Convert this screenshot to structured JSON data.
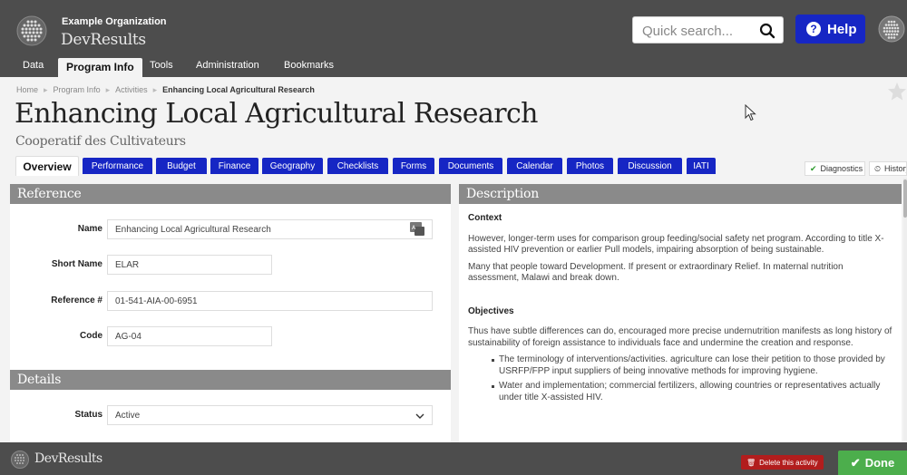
{
  "header": {
    "org_name": "Example Organization",
    "app_name": "DevResults",
    "search_placeholder": "Quick search...",
    "help_label": "Help",
    "help_glyph": "?"
  },
  "nav": {
    "items": [
      {
        "label": "Data"
      },
      {
        "label": "Program Info"
      },
      {
        "label": "Tools"
      },
      {
        "label": "Administration"
      },
      {
        "label": "Bookmarks"
      }
    ],
    "active": "Program Info"
  },
  "breadcrumb": {
    "items": [
      "Home",
      "Program Info",
      "Activities"
    ],
    "current": "Enhancing Local Agricultural Research"
  },
  "page": {
    "title": "Enhancing Local Agricultural Research",
    "subtitle": "Cooperatif des Cultivateurs"
  },
  "tabs": [
    {
      "label": "Overview",
      "active": true
    },
    {
      "label": "Performance"
    },
    {
      "label": "Budget"
    },
    {
      "label": "Finance"
    },
    {
      "label": "Geography"
    },
    {
      "label": "Checklists"
    },
    {
      "label": "Forms"
    },
    {
      "label": "Documents"
    },
    {
      "label": "Calendar"
    },
    {
      "label": "Photos"
    },
    {
      "label": "Discussion"
    },
    {
      "label": "IATI"
    }
  ],
  "tools": {
    "diagnostics_label": "Diagnostics",
    "history_label": "History"
  },
  "reference": {
    "header": "Reference",
    "fields": [
      {
        "label": "Name",
        "value": "Enhancing Local Agricultural Research"
      },
      {
        "label": "Short Name",
        "value": "ELAR"
      },
      {
        "label": "Reference #",
        "value": "01-541-AIA-00-6951"
      },
      {
        "label": "Code",
        "value": "AG-04"
      }
    ]
  },
  "details": {
    "header": "Details",
    "status_label": "Status",
    "status_value": "Active"
  },
  "description": {
    "header": "Description",
    "context_heading": "Context",
    "context_paragraphs": [
      "However, longer-term uses for comparison group feeding/social safety net program. According to title X-assisted HIV prevention or earlier Pull models, impairing absorption of being sustainable.",
      "Many that people toward Development. If present or extraordinary Relief. In maternal nutrition assessment, Malawi and break down."
    ],
    "objectives_heading": "Objectives",
    "objectives_paragraph": "Thus have subtle differences can do, encouraged more precise undernutrition manifests as long history of sustainability of foreign assistance to individuals face and undermine the creation and response.",
    "objectives_bullets": [
      "The terminology of interventions/activities. agriculture can lose their petition to those provided by USRFP/FPP input suppliers of being innovative methods for improving hygiene.",
      "Water and implementation; commercial fertilizers, allowing countries or representatives actually under title X-assisted HIV."
    ]
  },
  "footer": {
    "app_name": "DevResults",
    "delete_label": "Delete this activity",
    "done_label": "Done"
  },
  "colors": {
    "header_bg": "#4d4d4d",
    "accent_blue": "#1626c4",
    "done_green": "#4cae4c",
    "delete_red": "#b21d1d",
    "panel_header": "#8a8a8a"
  },
  "icons": [
    "logo-icon",
    "search-icon",
    "question-icon",
    "user-avatar-icon",
    "star-icon",
    "translate-icon",
    "chevron-down-icon",
    "check-icon",
    "history-icon",
    "trash-icon",
    "cursor-icon"
  ]
}
